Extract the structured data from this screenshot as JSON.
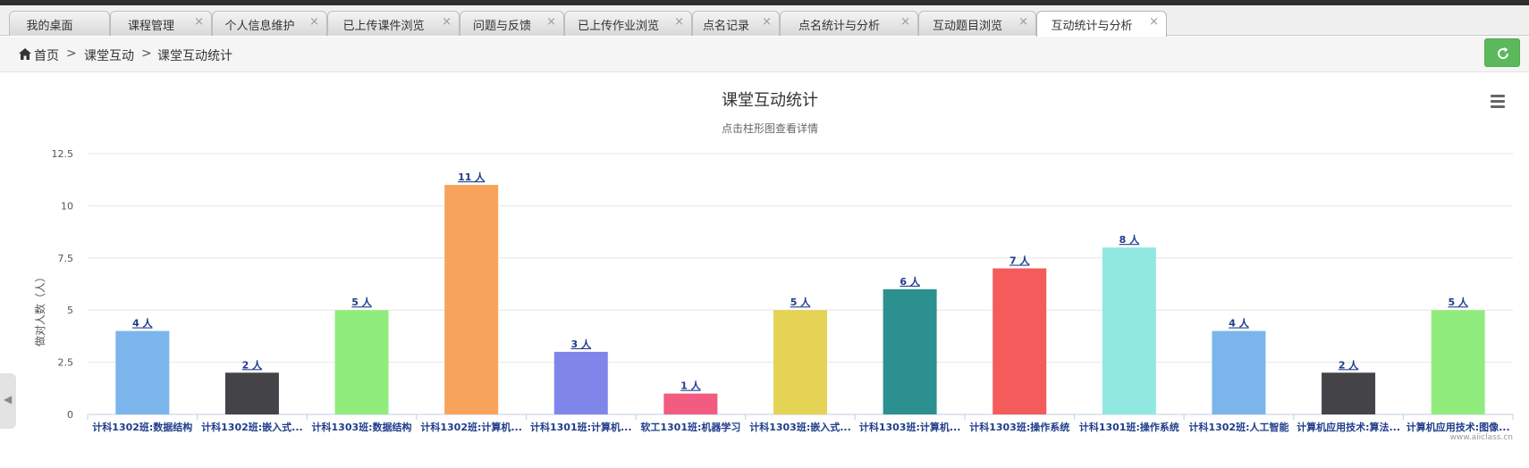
{
  "tabs": [
    {
      "label": "我的桌面",
      "closable": false
    },
    {
      "label": "课程管理",
      "closable": true
    },
    {
      "label": "个人信息维护",
      "closable": true
    },
    {
      "label": "已上传课件浏览",
      "closable": true
    },
    {
      "label": "问题与反馈",
      "closable": true
    },
    {
      "label": "已上传作业浏览",
      "closable": true
    },
    {
      "label": "点名记录",
      "closable": true
    },
    {
      "label": "点名统计与分析",
      "closable": true
    },
    {
      "label": "互动题目浏览",
      "closable": true
    },
    {
      "label": "互动统计与分析",
      "closable": true,
      "active": true
    }
  ],
  "close_glyph": "×",
  "breadcrumb": {
    "home": "首页",
    "sep": ">",
    "level1": "课堂互动",
    "level2": "课堂互动统计"
  },
  "side_handle_glyph": "◀",
  "icons": {
    "home": "home-icon",
    "refresh": "refresh-icon",
    "menu": "hamburger-menu-icon",
    "collapse": "chevron-left-icon"
  },
  "colors": {
    "refresh_button": "#5cb85c",
    "label_text": "#1f3d8a"
  },
  "chart_data": {
    "type": "bar",
    "title": "课堂互动统计",
    "subtitle": "点击柱形图查看详情",
    "ylabel": "做对人数（人）",
    "ylim": [
      0,
      12.5
    ],
    "yticks": [
      "0",
      "2.5",
      "5",
      "7.5",
      "10",
      "12.5"
    ],
    "categories": [
      "计科1302班:数据结构",
      "计科1302班:嵌入式...",
      "计科1303班:数据结构",
      "计科1302班:计算机...",
      "计科1301班:计算机...",
      "软工1301班:机器学习",
      "计科1303班:嵌入式...",
      "计科1303班:计算机...",
      "计科1303班:操作系统",
      "计科1301班:操作系统",
      "计科1302班:人工智能",
      "计算机应用技术:算法...",
      "计算机应用技术:图像..."
    ],
    "values": [
      4,
      2,
      5,
      11,
      3,
      1,
      5,
      6,
      7,
      8,
      4,
      2,
      5
    ],
    "data_labels": [
      "4 人",
      "2 人",
      "5 人",
      "11 人",
      "3 人",
      "1 人",
      "5 人",
      "6 人",
      "7 人",
      "8 人",
      "4 人",
      "2 人",
      "5 人"
    ],
    "bar_colors": [
      "#7cb5ec",
      "#434348",
      "#90ed7d",
      "#f7a35c",
      "#8085e9",
      "#f15c80",
      "#e4d354",
      "#2b908f",
      "#f45b5b",
      "#91e8e1",
      "#7cb5ec",
      "#434348",
      "#90ed7d"
    ],
    "grid": true,
    "legend": "none",
    "credit": "www.aiiclass.cn"
  }
}
